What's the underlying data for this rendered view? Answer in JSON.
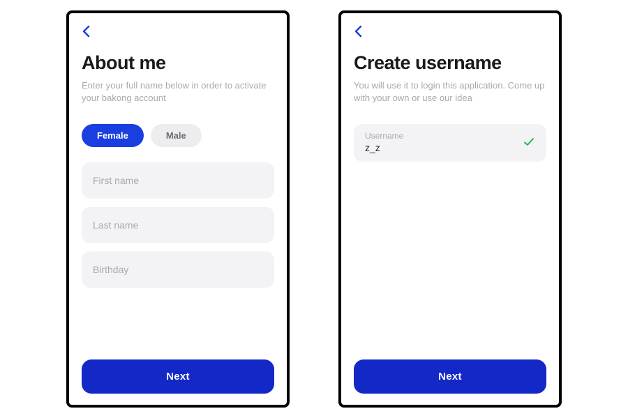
{
  "screen1": {
    "title": "About me",
    "subtitle": "Enter your full name below in order to activate your bakong account",
    "gender": {
      "female": "Female",
      "male": "Male"
    },
    "fields": {
      "first_name_placeholder": "First name",
      "last_name_placeholder": "Last name",
      "birthday_placeholder": "Birthday"
    },
    "next_label": "Next"
  },
  "screen2": {
    "title": "Create username",
    "subtitle": "You will use it to login this application. Come up with your own or use our idea",
    "username_field": {
      "label": "Username",
      "value": "z_z"
    },
    "next_label": "Next"
  },
  "colors": {
    "accent": "#1a3fe0",
    "button": "#1428c8",
    "field_bg": "#f3f3f5",
    "muted_text": "#a8a8b0",
    "success": "#2db84c"
  }
}
